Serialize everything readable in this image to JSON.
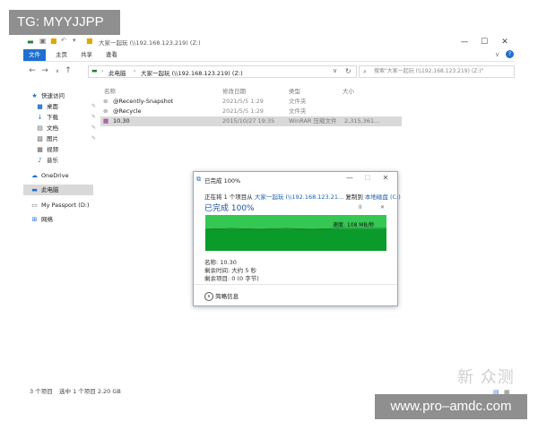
{
  "watermark_top": "TG: MYYJJPP",
  "window": {
    "title": "大家一起玩 (\\\\192.168.123.219) (Z:)",
    "controls": [
      "—",
      "☐",
      "✕"
    ],
    "help": "?"
  },
  "ribbon": {
    "tabs": [
      "文件",
      "主页",
      "共享",
      "查看"
    ]
  },
  "address": {
    "path": [
      "此电脑",
      "大家一起玩 (\\\\192.168.123.219) (Z:)"
    ],
    "search_placeholder": "搜索\"大家一起玩 (\\\\192.168.123.219) (Z:)\""
  },
  "sidebar": {
    "items": [
      {
        "label": "快速访问",
        "icon": "star-icon"
      },
      {
        "label": "桌面",
        "icon": "desktop-icon"
      },
      {
        "label": "下载",
        "icon": "download-icon"
      },
      {
        "label": "文档",
        "icon": "document-icon"
      },
      {
        "label": "图片",
        "icon": "picture-icon"
      },
      {
        "label": "视频",
        "icon": "video-icon"
      },
      {
        "label": "音乐",
        "icon": "music-icon"
      },
      {
        "label": "OneDrive",
        "icon": "cloud-icon"
      },
      {
        "label": "此电脑",
        "icon": "computer-icon"
      },
      {
        "label": "My Passport (D:)",
        "icon": "drive-icon"
      },
      {
        "label": "网络",
        "icon": "network-icon"
      }
    ]
  },
  "columns": [
    "名称",
    "修改日期",
    "类型",
    "大小"
  ],
  "files": [
    {
      "name": "@Recently-Snapshot",
      "date": "2021/5/5 1:29",
      "type": "文件夹",
      "size": ""
    },
    {
      "name": "@Recycle",
      "date": "2021/5/5 1:29",
      "type": "文件夹",
      "size": ""
    },
    {
      "name": "10.30",
      "date": "2015/10/27 19:35",
      "type": "WinRAR 压缩文件",
      "size": "2,315,361..."
    }
  ],
  "status": {
    "count": "3 个项目",
    "selected": "选中 1 个项目  2.20 GB"
  },
  "dialog": {
    "title": "已完成 100%",
    "line_prefix": "正在将 1 个项目从",
    "line_source": "大家一起玩 (\\\\192.168.123.21...",
    "line_mid": "复制到",
    "line_dest": "本地磁盘 (C:)",
    "big": "已完成 100%",
    "speed": "速度: 108 MB/秒",
    "progress_fraction": 1.0,
    "name": "名称: 10.30",
    "remaining_time": "剩余时间: 大约 5 秒",
    "remaining_items": "剩余项目: 0 (0 字节)",
    "details": "简略信息",
    "pause": "II",
    "cancel": "✕"
  },
  "watermark_brand": "新 众测",
  "watermark_url": "www.pro–amdc.com"
}
